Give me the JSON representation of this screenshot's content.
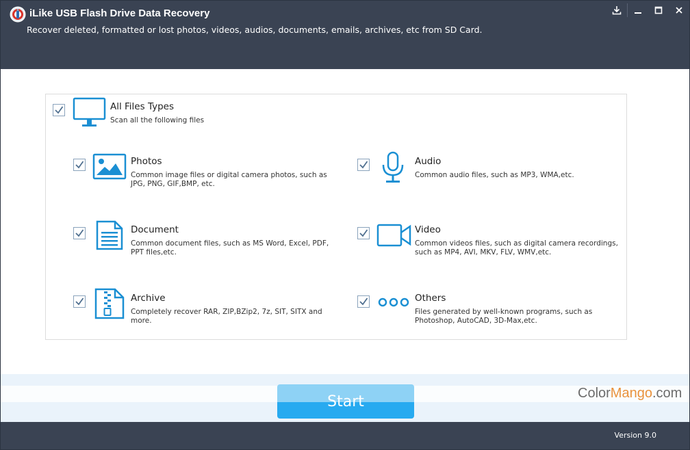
{
  "app": {
    "title": "iLike USB Flash Drive Data Recovery",
    "subtitle": "Recover deleted, formatted or lost photos, videos, audios, documents, emails, archives, etc from SD Card."
  },
  "window_controls": [
    "download-icon",
    "minimize-icon",
    "maximize-icon",
    "close-icon"
  ],
  "colors": {
    "header_bg": "#3a4353",
    "accent_icon": "#1a8fd3",
    "button_top": "#8ed2f5",
    "button_bottom": "#27aaf0",
    "checkbox_border": "#8aa3bc",
    "watermark_accent": "#e9923c"
  },
  "all_types": {
    "label": "All Files Types",
    "description": "Scan all the following files",
    "checked": true,
    "icon": "monitor-icon"
  },
  "file_types": [
    {
      "key": "photos",
      "label": "Photos",
      "description": "Common image files or digital camera photos, such as JPG, PNG, GIF,BMP, etc.",
      "checked": true,
      "icon": "image-icon"
    },
    {
      "key": "audio",
      "label": "Audio",
      "description": "Common audio files, such as MP3, WMA,etc.",
      "checked": true,
      "icon": "microphone-icon"
    },
    {
      "key": "document",
      "label": "Document",
      "description": "Common document files, such as MS Word, Excel, PDF, PPT files,etc.",
      "checked": true,
      "icon": "document-icon"
    },
    {
      "key": "video",
      "label": "Video",
      "description": "Common videos files, such as digital camera recordings, such as MP4, AVI, MKV, FLV, WMV,etc.",
      "checked": true,
      "icon": "video-camera-icon"
    },
    {
      "key": "archive",
      "label": "Archive",
      "description": "Completely recover RAR, ZIP,BZip2, 7z, SIT, SITX and more.",
      "checked": true,
      "icon": "zip-archive-icon"
    },
    {
      "key": "others",
      "label": "Others",
      "description": "Files generated by well-known programs, such as Photoshop, AutoCAD, 3D-Max,etc.",
      "checked": true,
      "icon": "more-dots-icon"
    }
  ],
  "start_label": "Start",
  "watermark": {
    "part1": "Color",
    "part2": "Mango",
    "part3": ".com"
  },
  "version": "Version 9.0"
}
